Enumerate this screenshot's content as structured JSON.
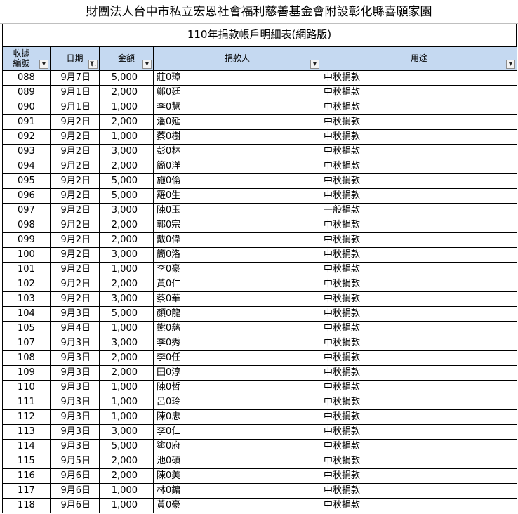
{
  "title": "財團法人台中市私立宏恩社會福利慈善基金會附設彰化縣喜願家園",
  "subtitle": "110年捐款帳戶明細表(網路版)",
  "columns": {
    "no_line1": "收據",
    "no_line2": "編號",
    "date": "日期",
    "amount": "金額",
    "donor": "捐款人",
    "purpose": "用途"
  },
  "icons": {
    "dropdown": "filter-dropdown-icon",
    "filter_active": "filter-active-icon"
  },
  "rows": [
    {
      "no": "088",
      "date": "9月7日",
      "amount": "5,000",
      "donor": "莊0璋",
      "purpose": "中秋捐款"
    },
    {
      "no": "089",
      "date": "9月1日",
      "amount": "2,000",
      "donor": "鄭0廷",
      "purpose": "中秋捐款"
    },
    {
      "no": "090",
      "date": "9月1日",
      "amount": "1,000",
      "donor": "李0慧",
      "purpose": "中秋捐款"
    },
    {
      "no": "091",
      "date": "9月2日",
      "amount": "2,000",
      "donor": "潘0延",
      "purpose": "中秋捐款"
    },
    {
      "no": "092",
      "date": "9月2日",
      "amount": "1,000",
      "donor": "蔡0樹",
      "purpose": "中秋捐款"
    },
    {
      "no": "093",
      "date": "9月2日",
      "amount": "3,000",
      "donor": "彭0林",
      "purpose": "中秋捐款"
    },
    {
      "no": "094",
      "date": "9月2日",
      "amount": "2,000",
      "donor": "簡0洋",
      "purpose": "中秋捐款"
    },
    {
      "no": "095",
      "date": "9月2日",
      "amount": "5,000",
      "donor": "施0倫",
      "purpose": "中秋捐款"
    },
    {
      "no": "096",
      "date": "9月2日",
      "amount": "5,000",
      "donor": "羅0生",
      "purpose": "中秋捐款"
    },
    {
      "no": "097",
      "date": "9月2日",
      "amount": "3,000",
      "donor": "陳0玉",
      "purpose": "一般捐款"
    },
    {
      "no": "098",
      "date": "9月2日",
      "amount": "2,000",
      "donor": "郭0宗",
      "purpose": "中秋捐款"
    },
    {
      "no": "099",
      "date": "9月2日",
      "amount": "2,000",
      "donor": "戴0偉",
      "purpose": "中秋捐款"
    },
    {
      "no": "100",
      "date": "9月2日",
      "amount": "3,000",
      "donor": "簡0洛",
      "purpose": "中秋捐款"
    },
    {
      "no": "101",
      "date": "9月2日",
      "amount": "1,000",
      "donor": "李0豪",
      "purpose": "中秋捐款"
    },
    {
      "no": "102",
      "date": "9月2日",
      "amount": "2,000",
      "donor": "黃0仁",
      "purpose": "中秋捐款"
    },
    {
      "no": "103",
      "date": "9月2日",
      "amount": "3,000",
      "donor": "蔡0華",
      "purpose": "中秋捐款"
    },
    {
      "no": "104",
      "date": "9月3日",
      "amount": "5,000",
      "donor": "顏0龍",
      "purpose": "中秋捐款"
    },
    {
      "no": "105",
      "date": "9月4日",
      "amount": "1,000",
      "donor": "熊0慈",
      "purpose": "中秋捐款"
    },
    {
      "no": "107",
      "date": "9月3日",
      "amount": "3,000",
      "donor": "李0秀",
      "purpose": "中秋捐款"
    },
    {
      "no": "108",
      "date": "9月3日",
      "amount": "2,000",
      "donor": "李0任",
      "purpose": "中秋捐款"
    },
    {
      "no": "109",
      "date": "9月3日",
      "amount": "2,000",
      "donor": "田0淳",
      "purpose": "中秋捐款"
    },
    {
      "no": "110",
      "date": "9月3日",
      "amount": "1,000",
      "donor": "陳0哲",
      "purpose": "中秋捐款"
    },
    {
      "no": "111",
      "date": "9月3日",
      "amount": "1,000",
      "donor": "呂0玲",
      "purpose": "中秋捐款"
    },
    {
      "no": "112",
      "date": "9月3日",
      "amount": "1,000",
      "donor": "陳0忠",
      "purpose": "中秋捐款"
    },
    {
      "no": "113",
      "date": "9月3日",
      "amount": "3,000",
      "donor": "李0仁",
      "purpose": "中秋捐款"
    },
    {
      "no": "114",
      "date": "9月3日",
      "amount": "5,000",
      "donor": "塗0府",
      "purpose": "中秋捐款"
    },
    {
      "no": "115",
      "date": "9月5日",
      "amount": "2,000",
      "donor": "池0碩",
      "purpose": "中秋捐款"
    },
    {
      "no": "116",
      "date": "9月6日",
      "amount": "2,000",
      "donor": "陳0美",
      "purpose": "中秋捐款"
    },
    {
      "no": "117",
      "date": "9月6日",
      "amount": "1,000",
      "donor": "林0鏞",
      "purpose": "中秋捐款"
    },
    {
      "no": "118",
      "date": "9月6日",
      "amount": "1,000",
      "donor": "黃0豪",
      "purpose": "中秋捐款"
    }
  ]
}
